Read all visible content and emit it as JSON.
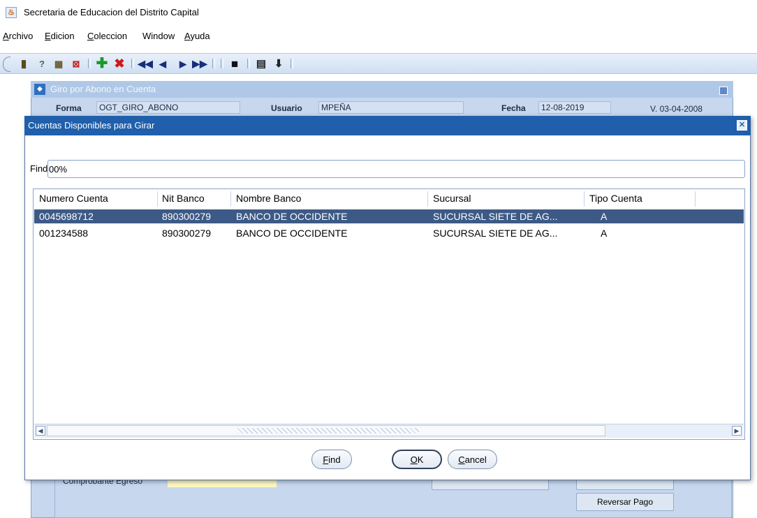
{
  "window": {
    "title": "Secretaria de Educacion del Distrito Capital"
  },
  "menu": {
    "items": [
      {
        "mnemonic": "A",
        "rest": "rchivo"
      },
      {
        "mnemonic": "E",
        "rest": "dicion"
      },
      {
        "mnemonic": "C",
        "rest": "oleccion"
      },
      {
        "mnemonic": "",
        "rest": "Window"
      },
      {
        "mnemonic": "A",
        "rest": "yuda"
      }
    ]
  },
  "toolbar": {
    "icons": [
      "exit-door-icon",
      "query-help-icon",
      "query-execute-icon",
      "query-cancel-icon",
      "insert-record-icon",
      "delete-record-icon",
      "first-record-icon",
      "previous-record-icon",
      "next-record-icon",
      "last-record-icon",
      "save-icon",
      "print-icon",
      "download-icon"
    ]
  },
  "background_form": {
    "title": "Giro por Abono en Cuenta",
    "forma_label": "Forma",
    "forma_value": "OGT_GIRO_ABONO",
    "usuario_label": "Usuario",
    "usuario_value": "MPEÑA",
    "fecha_label": "Fecha",
    "fecha_value": "12-08-2019",
    "version": "V. 03-04-2008",
    "comprobante_label": "Comprobante Egreso",
    "reversar_label": "Reversar Pago"
  },
  "dialog": {
    "title": "Cuentas Disponibles para Girar",
    "find_label": "Find",
    "find_value": "00%",
    "columns": [
      "Numero Cuenta",
      "Nit Banco",
      "Nombre Banco",
      "Sucursal",
      "Tipo Cuenta"
    ],
    "rows": [
      {
        "numero": "0045698712",
        "nit": "890300279",
        "banco": "BANCO DE OCCIDENTE",
        "sucursal": "SUCURSAL SIETE DE AG...",
        "tipo": "A",
        "selected": true
      },
      {
        "numero": "001234588",
        "nit": "890300279",
        "banco": "BANCO DE OCCIDENTE",
        "sucursal": "SUCURSAL SIETE DE AG...",
        "tipo": "A",
        "selected": false
      }
    ],
    "buttons": {
      "find": {
        "mnemonic": "F",
        "rest": "ind"
      },
      "ok": {
        "mnemonic": "O",
        "rest": "K"
      },
      "cancel": {
        "mnemonic": "C",
        "rest": "ancel"
      }
    }
  },
  "colors": {
    "dialog_title_bg": "#1f5fab",
    "selected_row_bg": "#3d5a86",
    "form_bg": "#c7d7ee"
  }
}
